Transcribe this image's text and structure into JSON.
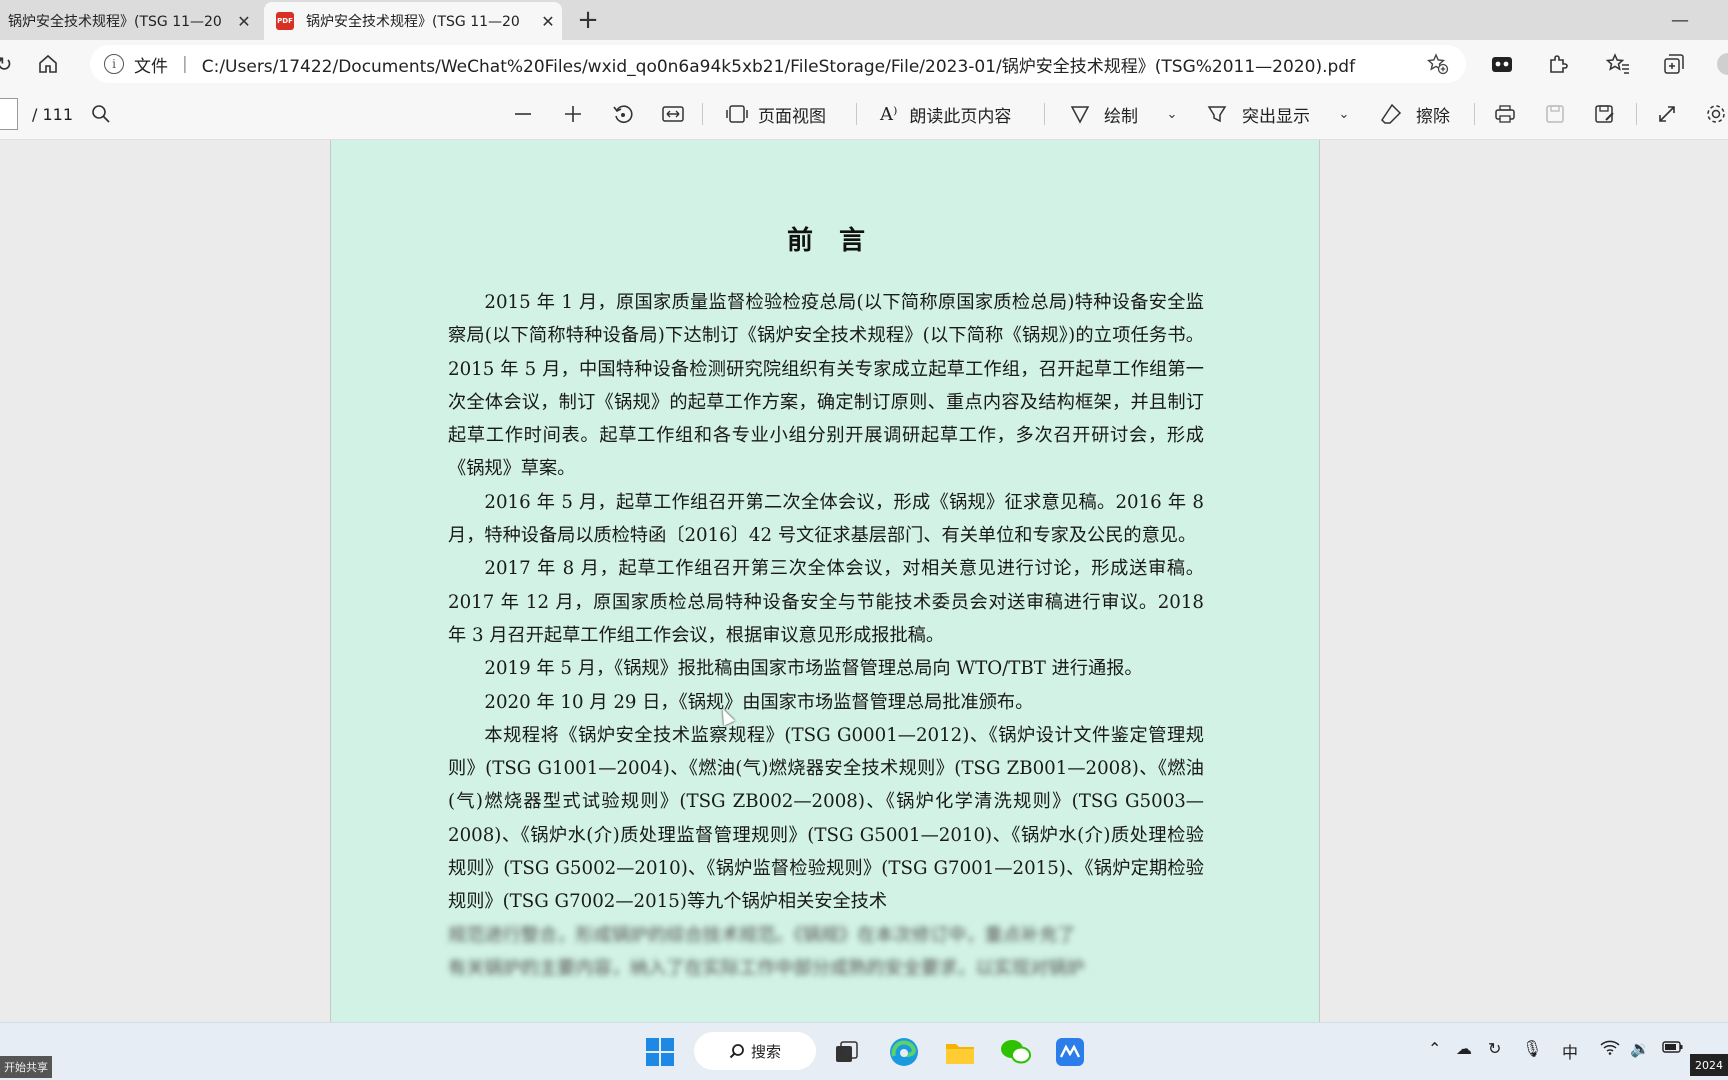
{
  "tabs": [
    {
      "title": "锅炉安全技术规程》(TSG 11—20",
      "active": false
    },
    {
      "title": "锅炉安全技术规程》(TSG 11—20",
      "active": true
    }
  ],
  "tab_close_glyph": "✕",
  "new_tab_glyph": "+",
  "address": {
    "info_label": "文件",
    "url": "C:/Users/17422/Documents/WeChat%20Files/wxid_qo0n6a94k5xb21/FileStorage/File/2023-01/锅炉安全技术规程》(TSG%2011—2020).pdf"
  },
  "pdf_toolbar": {
    "page_total": "/ 111",
    "page_view_label": "页面视图",
    "read_aloud_label": "朗读此页内容",
    "draw_label": "绘制",
    "highlight_label": "突出显示",
    "erase_label": "擦除"
  },
  "document": {
    "title": "前言",
    "paragraphs": [
      "2015 年 1 月，原国家质量监督检验检疫总局(以下简称原国家质检总局)特种设备安全监察局(以下简称特种设备局)下达制订《锅炉安全技术规程》(以下简称《锅规》)的立项任务书。2015 年 5 月，中国特种设备检测研究院组织有关专家成立起草工作组，召开起草工作组第一次全体会议，制订《锅规》的起草工作方案，确定制订原则、重点内容及结构框架，并且制订起草工作时间表。起草工作组和各专业小组分别开展调研起草工作，多次召开研讨会，形成《锅规》草案。",
      "2016 年 5 月，起草工作组召开第二次全体会议，形成《锅规》征求意见稿。2016 年 8 月，特种设备局以质检特函〔2016〕42 号文征求基层部门、有关单位和专家及公民的意见。",
      "2017 年 8 月，起草工作组召开第三次全体会议，对相关意见进行讨论，形成送审稿。2017 年 12 月，原国家质检总局特种设备安全与节能技术委员会对送审稿进行审议。2018 年 3 月召开起草工作组工作会议，根据审议意见形成报批稿。",
      "2019 年 5 月，《锅规》报批稿由国家市场监督管理总局向 WTO/TBT 进行通报。",
      "2020 年 10 月 29 日，《锅规》由国家市场监督管理总局批准颁布。",
      "本规程将《锅炉安全技术监察规程》(TSG G0001—2012)、《锅炉设计文件鉴定管理规则》(TSG G1001—2004)、《燃油(气)燃烧器安全技术规则》(TSG ZB001—2008)、《燃油(气)燃烧器型式试验规则》(TSG ZB002—2008)、《锅炉化学清洗规则》(TSG G5003—2008)、《锅炉水(介)质处理监督管理规则》(TSG G5001—2010)、《锅炉水(介)质处理检验规则》(TSG G5002—2010)、《锅炉监督检验规则》(TSG G7001—2015)、《锅炉定期检验规则》(TSG G7002—2015)等九个锅炉相关安全技术"
    ],
    "blurred_lines": [
      "规范进行整合，形成锅炉的综合技术规范。《锅规》在本次修订中，重点补充了",
      "有关锅炉的主要内容，纳入了在实际工作中部分成熟的安全要求，以实现对锅炉"
    ]
  },
  "taskbar": {
    "search_label": "搜索",
    "ime_label": "中",
    "clock_partial": "2024",
    "share_badge": "开始共享"
  }
}
